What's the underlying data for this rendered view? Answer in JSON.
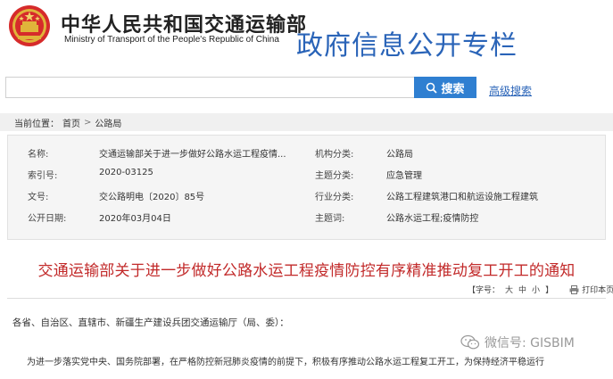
{
  "header": {
    "ministry_cn": "中华人民共和国交通运输部",
    "ministry_en": "Ministry of Transport of the People's Republic of China",
    "column_title": "政府信息公开专栏"
  },
  "search": {
    "placeholder": "",
    "button_label": "搜索",
    "advanced_label": "高级搜索",
    "button_color": "#2f7fd1"
  },
  "breadcrumb": {
    "prefix": "当前位置：",
    "items": [
      "首页",
      "公路局"
    ],
    "separator": ">"
  },
  "info": {
    "rows": [
      {
        "label1": "名称:",
        "value1": "交通运输部关于进一步做好公路水运工程疫情...",
        "label2": "机构分类:",
        "value2": "公路局"
      },
      {
        "label1": "索引号:",
        "value1": "2020-03125",
        "label2": "主题分类:",
        "value2": "应急管理"
      },
      {
        "label1": "文号:",
        "value1": "交公路明电〔2020〕85号",
        "label2": "行业分类:",
        "value2": "公路工程建筑港口和航运设施工程建筑"
      },
      {
        "label1": "公开日期:",
        "value1": "2020年03月04日",
        "label2": "主题词:",
        "value2": "公路水运工程;疫情防控"
      }
    ]
  },
  "document": {
    "title": "交通运输部关于进一步做好公路水运工程疫情防控有序精准推动复工开工的通知",
    "font_size_label": "【字号：",
    "sizes": [
      "大",
      "中",
      "小"
    ],
    "font_size_end": "】",
    "print_label": "打印本页",
    "paragraph1": "各省、自治区、直辖市、新疆生产建设兵团交通运输厅（局、委）：",
    "paragraph2": "为进一步落实党中央、国务院部署，在严格防控新冠肺炎疫情的前提下，积极有序推动公路水运工程复工开工，为保持经济平稳运行"
  },
  "watermark": {
    "text": "微信号: GISBIM",
    "icon": "wechat-icon"
  },
  "colors": {
    "title_red": "#c22a2a",
    "brand_blue": "#2a64b8"
  }
}
